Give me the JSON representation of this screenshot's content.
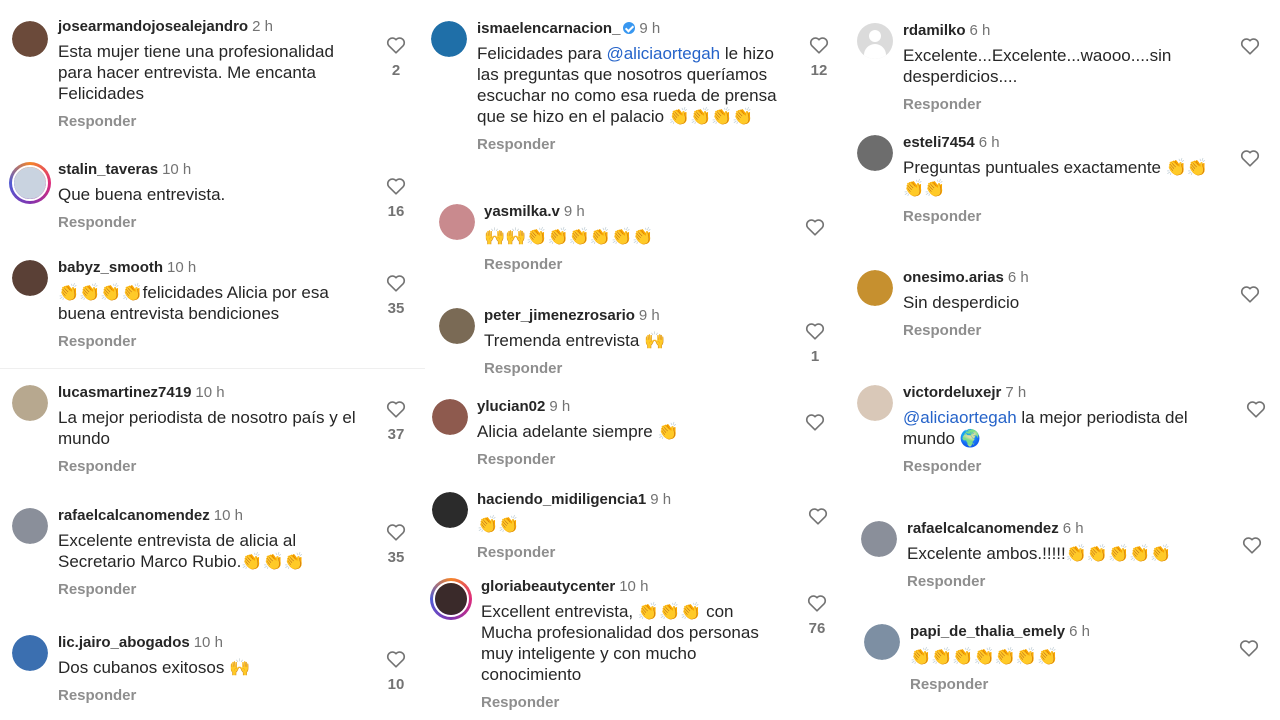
{
  "columns": [
    {
      "comments": [
        {
          "user": "josearmandojosealejandro",
          "time": "2 h",
          "text": "Esta mujer tiene una profesionalidad para hacer entrevista. Me encanta Felicidades",
          "reply": "Responder",
          "likes": "2",
          "avatar_color": "#6b4a3a"
        },
        {
          "user": "stalin_taveras",
          "time": "10 h",
          "text": "Que buena entrevista.",
          "reply": "Responder",
          "likes": "16",
          "avatar_color": "#c9d3e0"
        },
        {
          "user": "babyz_smooth",
          "time": "10 h",
          "text": "👏👏👏👏felicidades Alicia por esa buena entrevista bendiciones",
          "reply": "Responder",
          "likes": "35",
          "avatar_color": "#5a4036"
        },
        {
          "user": "lucasmartinez7419",
          "time": "10 h",
          "text": "La mejor periodista de nosotro país y el mundo",
          "reply": "Responder",
          "likes": "37",
          "avatar_color": "#b7a88f"
        },
        {
          "user": "rafaelcalcanomendez",
          "time": "10 h",
          "text": "Excelente entrevista de alicia al Secretario Marco Rubio.👏👏👏",
          "reply": "Responder",
          "likes": "35",
          "avatar_color": "#8a8f9a"
        },
        {
          "user": "lic.jairo_abogados",
          "time": "10 h",
          "text": "Dos cubanos exitosos 🙌",
          "reply": "Responder",
          "likes": "10",
          "avatar_color": "#3b6fb0"
        }
      ]
    },
    {
      "comments": [
        {
          "user": "ismaelencarnacion_",
          "time": "9 h",
          "text_before": "Felicidades para ",
          "mention": "@aliciaortegah",
          "text": " le hizo las preguntas que nosotros queríamos escuchar no como esa rueda de prensa que se hizo en el palacio 👏👏👏👏",
          "reply": "Responder",
          "likes": "12",
          "avatar_color": "#1f6fa8"
        },
        {
          "user": "yasmilka.v",
          "time": "9 h",
          "text": "🙌🙌👏👏👏👏👏👏",
          "reply": "Responder",
          "likes": "",
          "avatar_color": "#c98a8e"
        },
        {
          "user": "peter_jimenezrosario",
          "time": "9 h",
          "text": "Tremenda entrevista 🙌",
          "reply": "Responder",
          "likes": "1",
          "avatar_color": "#7a6a55"
        },
        {
          "user": "ylucian02",
          "time": "9 h",
          "text": "Alicia adelante siempre 👏",
          "reply": "Responder",
          "likes": "",
          "avatar_color": "#8e5a4e"
        },
        {
          "user": "haciendo_midiligencia1",
          "time": "9 h",
          "text": "👏👏",
          "reply": "Responder",
          "likes": "",
          "avatar_color": "#2b2b2b"
        },
        {
          "user": "gloriabeautycenter",
          "time": "10 h",
          "text": "Excellent entrevista, 👏👏👏 con Mucha profesionalidad dos personas muy inteligente y con mucho conocimiento",
          "reply": "Responder",
          "likes": "76",
          "avatar_color": "#3a2a2a"
        }
      ]
    },
    {
      "comments": [
        {
          "user": "rdamilko",
          "time": "6 h",
          "text": "Excelente...Excelente...waooo....sin desperdicios....",
          "reply": "Responder",
          "likes": "",
          "avatar_color": "#dbdbdb"
        },
        {
          "user": "esteli7454",
          "time": "6 h",
          "text": "Preguntas puntuales exactamente 👏👏👏👏",
          "reply": "Responder",
          "likes": "",
          "avatar_color": "#6d6d6d"
        },
        {
          "user": "onesimo.arias",
          "time": "6 h",
          "text": "Sin desperdicio",
          "reply": "Responder",
          "likes": "",
          "avatar_color": "#c6902f"
        },
        {
          "user": "victordeluxejr",
          "time": "7 h",
          "mention": "@aliciaortegah",
          "text": " la mejor periodista del mundo 🌍",
          "reply": "Responder",
          "likes": "",
          "avatar_color": "#d9c8b8"
        },
        {
          "user": "rafaelcalcanomendez",
          "time": "6 h",
          "text": "Excelente ambos.!!!!!👏👏👏👏👏",
          "reply": "Responder",
          "likes": "",
          "avatar_color": "#8a8f9a"
        },
        {
          "user": "papi_de_thalia_emely",
          "time": "6 h",
          "text": "👏👏👏👏👏👏👏",
          "reply": "Responder",
          "likes": "",
          "avatar_color": "#7d8fa3"
        }
      ]
    }
  ]
}
